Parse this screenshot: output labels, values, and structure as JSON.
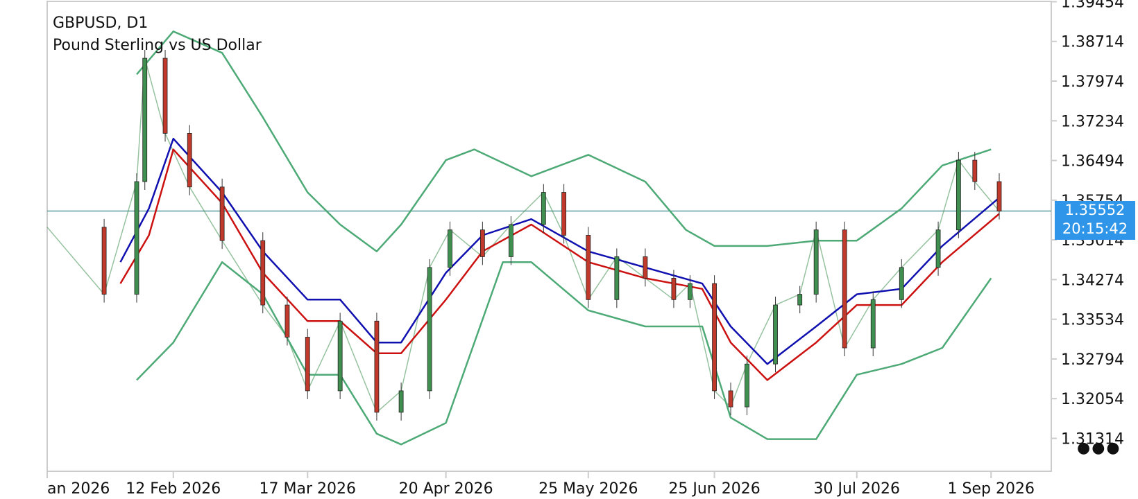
{
  "header": {
    "symbol": "GBPUSD, D1",
    "description": "Pound Sterling vs US Dollar"
  },
  "price_badge": {
    "price": "1.35552",
    "countdown": "20:15:42"
  },
  "menu": {
    "icon": "more-dots-icon"
  },
  "colors": {
    "bull": "#3f8f50",
    "bear": "#c0392b",
    "bollinger": "#4daa76",
    "ma_fast": "#1010b0",
    "ma_slow": "#cc1111",
    "price_line": "#5a9a9a",
    "badge": "#2f95e8",
    "frame": "#cccccc"
  },
  "chart_data": {
    "type": "candlestick",
    "y_ticks": [
      "1.39454",
      "1.38714",
      "1.37974",
      "1.37234",
      "1.36494",
      "1.35754",
      "1.35014",
      "1.34274",
      "1.33534",
      "1.32794",
      "1.32054",
      "1.31314"
    ],
    "ylim": [
      1.307,
      1.3946
    ],
    "x_ticks": [
      {
        "label": "an 2026",
        "date": "2026-01-12"
      },
      {
        "label": "12 Feb 2026",
        "date": "2026-02-12"
      },
      {
        "label": "17 Mar 2026",
        "date": "2026-03-17"
      },
      {
        "label": "20 Apr 2026",
        "date": "2026-04-20"
      },
      {
        "label": "25 May 2026",
        "date": "2026-05-25"
      },
      {
        "label": "25 Jun 2026",
        "date": "2026-06-25"
      },
      {
        "label": "30 Jul 2026",
        "date": "2026-07-30"
      },
      {
        "label": "1 Sep 2026",
        "date": "2026-09-01"
      }
    ],
    "x_range": [
      "2026-01-12",
      "2026-09-03"
    ],
    "current_price": 1.35552,
    "series": [
      {
        "name": "Close",
        "points": [
          [
            "2026-01-12",
            1.3525
          ],
          [
            "2026-01-26",
            1.34
          ],
          [
            "2026-02-03",
            1.361
          ],
          [
            "2026-02-05",
            1.384
          ],
          [
            "2026-02-10",
            1.37
          ],
          [
            "2026-02-16",
            1.36
          ],
          [
            "2026-02-24",
            1.35
          ],
          [
            "2026-03-06",
            1.338
          ],
          [
            "2026-03-12",
            1.332
          ],
          [
            "2026-03-17",
            1.322
          ],
          [
            "2026-03-25",
            1.335
          ],
          [
            "2026-04-03",
            1.318
          ],
          [
            "2026-04-09",
            1.322
          ],
          [
            "2026-04-16",
            1.345
          ],
          [
            "2026-04-21",
            1.352
          ],
          [
            "2026-04-29",
            1.347
          ],
          [
            "2026-05-06",
            1.353
          ],
          [
            "2026-05-14",
            1.359
          ],
          [
            "2026-05-19",
            1.351
          ],
          [
            "2026-05-25",
            1.339
          ],
          [
            "2026-06-01",
            1.347
          ],
          [
            "2026-06-08",
            1.343
          ],
          [
            "2026-06-15",
            1.339
          ],
          [
            "2026-06-19",
            1.342
          ],
          [
            "2026-06-25",
            1.322
          ],
          [
            "2026-06-29",
            1.319
          ],
          [
            "2026-07-03",
            1.327
          ],
          [
            "2026-07-10",
            1.338
          ],
          [
            "2026-07-16",
            1.34
          ],
          [
            "2026-07-20",
            1.352
          ],
          [
            "2026-07-27",
            1.33
          ],
          [
            "2026-08-03",
            1.339
          ],
          [
            "2026-08-10",
            1.345
          ],
          [
            "2026-08-19",
            1.352
          ],
          [
            "2026-08-24",
            1.365
          ],
          [
            "2026-08-28",
            1.361
          ],
          [
            "2026-09-03",
            1.3555
          ]
        ]
      },
      {
        "name": "BB Upper",
        "points": [
          [
            "2026-02-03",
            1.381
          ],
          [
            "2026-02-12",
            1.389
          ],
          [
            "2026-02-24",
            1.385
          ],
          [
            "2026-03-06",
            1.373
          ],
          [
            "2026-03-17",
            1.359
          ],
          [
            "2026-03-25",
            1.353
          ],
          [
            "2026-04-03",
            1.348
          ],
          [
            "2026-04-09",
            1.353
          ],
          [
            "2026-04-20",
            1.365
          ],
          [
            "2026-04-27",
            1.367
          ],
          [
            "2026-05-11",
            1.362
          ],
          [
            "2026-05-25",
            1.366
          ],
          [
            "2026-06-08",
            1.361
          ],
          [
            "2026-06-18",
            1.352
          ],
          [
            "2026-06-25",
            1.349
          ],
          [
            "2026-07-08",
            1.349
          ],
          [
            "2026-07-20",
            1.35
          ],
          [
            "2026-07-30",
            1.35
          ],
          [
            "2026-08-10",
            1.356
          ],
          [
            "2026-08-20",
            1.364
          ],
          [
            "2026-09-01",
            1.367
          ]
        ]
      },
      {
        "name": "BB Lower",
        "points": [
          [
            "2026-02-03",
            1.324
          ],
          [
            "2026-02-12",
            1.331
          ],
          [
            "2026-02-24",
            1.346
          ],
          [
            "2026-03-06",
            1.34
          ],
          [
            "2026-03-17",
            1.325
          ],
          [
            "2026-03-25",
            1.325
          ],
          [
            "2026-04-03",
            1.314
          ],
          [
            "2026-04-09",
            1.312
          ],
          [
            "2026-04-20",
            1.316
          ],
          [
            "2026-05-04",
            1.346
          ],
          [
            "2026-05-11",
            1.346
          ],
          [
            "2026-05-25",
            1.337
          ],
          [
            "2026-06-08",
            1.334
          ],
          [
            "2026-06-22",
            1.334
          ],
          [
            "2026-06-29",
            1.317
          ],
          [
            "2026-07-08",
            1.313
          ],
          [
            "2026-07-20",
            1.313
          ],
          [
            "2026-07-30",
            1.325
          ],
          [
            "2026-08-10",
            1.327
          ],
          [
            "2026-08-20",
            1.33
          ],
          [
            "2026-09-01",
            1.343
          ]
        ]
      },
      {
        "name": "MA Fast",
        "points": [
          [
            "2026-01-30",
            1.346
          ],
          [
            "2026-02-06",
            1.356
          ],
          [
            "2026-02-12",
            1.369
          ],
          [
            "2026-02-24",
            1.359
          ],
          [
            "2026-03-06",
            1.348
          ],
          [
            "2026-03-17",
            1.339
          ],
          [
            "2026-03-25",
            1.339
          ],
          [
            "2026-04-03",
            1.331
          ],
          [
            "2026-04-09",
            1.331
          ],
          [
            "2026-04-20",
            1.344
          ],
          [
            "2026-04-29",
            1.351
          ],
          [
            "2026-05-11",
            1.354
          ],
          [
            "2026-05-25",
            1.348
          ],
          [
            "2026-06-08",
            1.345
          ],
          [
            "2026-06-22",
            1.342
          ],
          [
            "2026-06-29",
            1.334
          ],
          [
            "2026-07-08",
            1.327
          ],
          [
            "2026-07-20",
            1.334
          ],
          [
            "2026-07-30",
            1.34
          ],
          [
            "2026-08-10",
            1.341
          ],
          [
            "2026-08-20",
            1.349
          ],
          [
            "2026-09-03",
            1.358
          ]
        ]
      },
      {
        "name": "MA Slow",
        "points": [
          [
            "2026-01-30",
            1.342
          ],
          [
            "2026-02-06",
            1.351
          ],
          [
            "2026-02-12",
            1.367
          ],
          [
            "2026-02-24",
            1.357
          ],
          [
            "2026-03-06",
            1.344
          ],
          [
            "2026-03-17",
            1.335
          ],
          [
            "2026-03-25",
            1.335
          ],
          [
            "2026-04-03",
            1.329
          ],
          [
            "2026-04-09",
            1.329
          ],
          [
            "2026-04-20",
            1.339
          ],
          [
            "2026-04-29",
            1.348
          ],
          [
            "2026-05-11",
            1.353
          ],
          [
            "2026-05-25",
            1.346
          ],
          [
            "2026-06-08",
            1.343
          ],
          [
            "2026-06-22",
            1.341
          ],
          [
            "2026-06-29",
            1.331
          ],
          [
            "2026-07-08",
            1.324
          ],
          [
            "2026-07-20",
            1.331
          ],
          [
            "2026-07-30",
            1.338
          ],
          [
            "2026-08-10",
            1.338
          ],
          [
            "2026-08-20",
            1.346
          ],
          [
            "2026-09-03",
            1.355
          ]
        ]
      }
    ]
  }
}
